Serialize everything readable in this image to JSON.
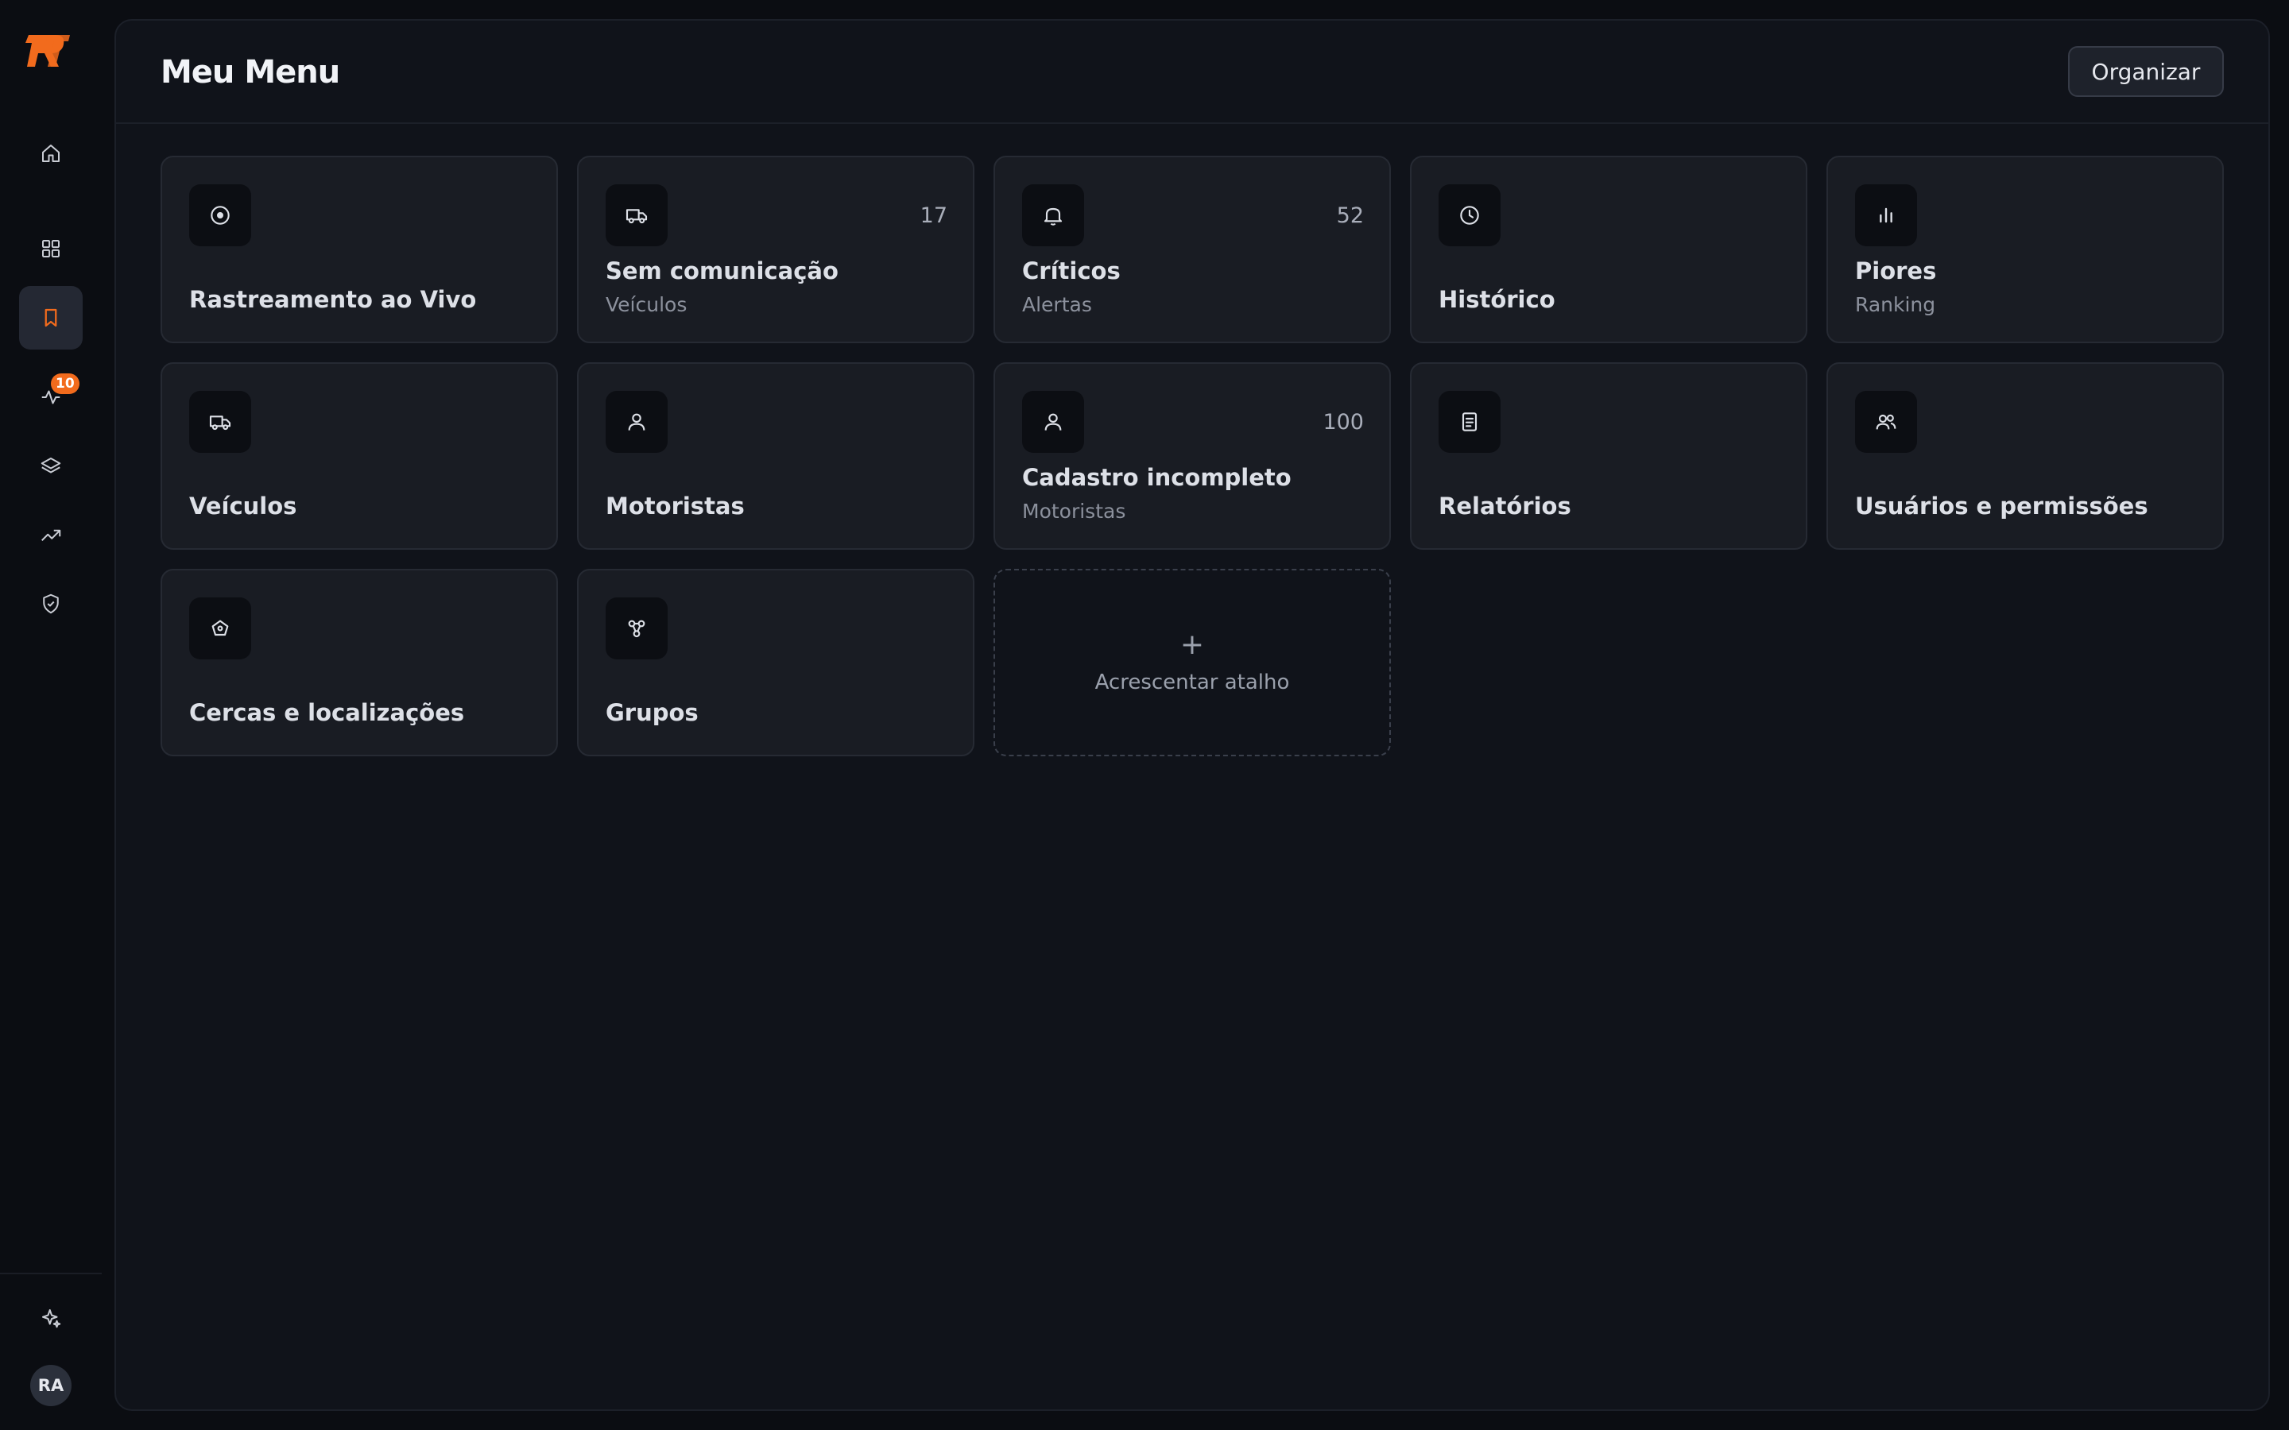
{
  "sidebar": {
    "badge": "10",
    "avatar_initials": "RA",
    "items": [
      {
        "icon": "home-icon"
      },
      {
        "icon": "grid-icon"
      },
      {
        "icon": "bookmark-icon",
        "active": true
      },
      {
        "icon": "activity-icon"
      },
      {
        "icon": "layers-icon"
      },
      {
        "icon": "trending-up-icon"
      },
      {
        "icon": "shield-check-icon"
      }
    ]
  },
  "colors": {
    "accent": "#f26b1d",
    "background": "#0b0d12",
    "panel": "#10131a",
    "card": "#191c23"
  },
  "header": {
    "title": "Meu Menu",
    "organize_label": "Organizar"
  },
  "cards": [
    {
      "title": "Rastreamento ao Vivo",
      "icon": "target-icon"
    },
    {
      "title": "Sem comunicação",
      "subtitle": "Veículos",
      "count": "17",
      "icon": "truck-icon"
    },
    {
      "title": "Críticos",
      "subtitle": "Alertas",
      "count": "52",
      "icon": "bell-icon"
    },
    {
      "title": "Histórico",
      "icon": "clock-icon"
    },
    {
      "title": "Piores",
      "subtitle": "Ranking",
      "icon": "bar-chart-icon"
    },
    {
      "title": "Veículos",
      "icon": "truck-icon"
    },
    {
      "title": "Motoristas",
      "icon": "user-icon"
    },
    {
      "title": "Cadastro incompleto",
      "subtitle": "Motoristas",
      "count": "100",
      "icon": "user-icon"
    },
    {
      "title": "Relatórios",
      "icon": "document-icon"
    },
    {
      "title": "Usuários e permissões",
      "icon": "users-icon"
    },
    {
      "title": "Cercas e localizações",
      "icon": "geofence-icon"
    },
    {
      "title": "Grupos",
      "icon": "groups-icon"
    }
  ],
  "add_shortcut": {
    "plus": "+",
    "label": "Acrescentar atalho"
  }
}
